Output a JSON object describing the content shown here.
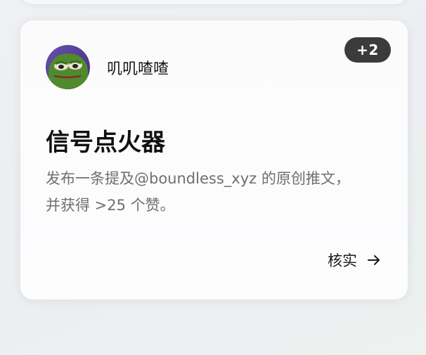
{
  "card": {
    "badge": "+2",
    "user": {
      "name": "叽叽喳喳",
      "avatar_icon": "pepe-frog-avatar"
    },
    "title": "信号点火器",
    "description_line1": "发布一条提及@boundless_xyz 的原创推文，",
    "description_line2": "并获得 >25 个赞。",
    "action": {
      "label": "核实",
      "icon": "arrow-right-icon"
    }
  }
}
